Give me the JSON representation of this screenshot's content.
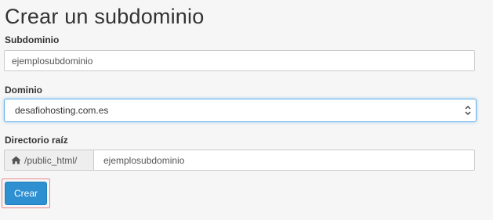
{
  "form": {
    "title": "Crear un subdominio",
    "subdomain": {
      "label": "Subdominio",
      "value": "ejemplosubdominio"
    },
    "domain": {
      "label": "Dominio",
      "selected": "desafiohosting.com.es"
    },
    "document_root": {
      "label": "Directorio raíz",
      "prefix": "/public_html/",
      "value": "ejemplosubdominio",
      "icon": "home-icon"
    },
    "submit_label": "Crear"
  },
  "colors": {
    "background": "#f6f6f6",
    "primary_button": "#2e8fd1",
    "focus_border": "#66afe9",
    "highlight_frame": "#e8888e"
  }
}
